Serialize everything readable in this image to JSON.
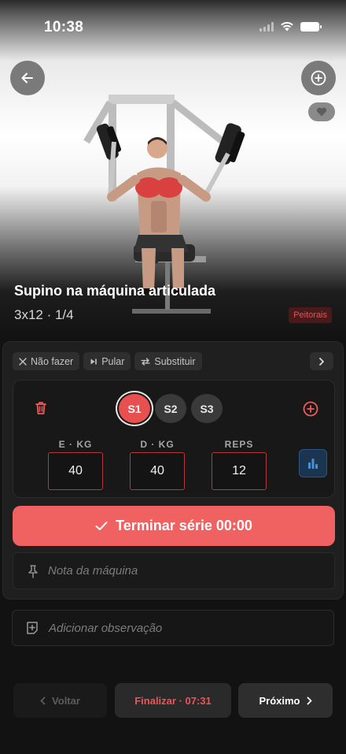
{
  "status_bar": {
    "time": "10:38"
  },
  "exercise": {
    "title": "Supino na máquina articulada",
    "meta": "3x12 · 1/4",
    "muscle": "Peitorais"
  },
  "actions": {
    "skip_label": "Não fazer",
    "jump_label": "Pular",
    "substitute_label": "Substituir"
  },
  "sets": {
    "pills": [
      "S1",
      "S2",
      "S3"
    ],
    "active": "S1"
  },
  "fields": {
    "left_label": "E · KG",
    "left_value": "40",
    "right_label": "D · KG",
    "right_value": "40",
    "reps_label": "REPS",
    "reps_value": "12"
  },
  "finish_set": {
    "label": "Terminar série 00:00"
  },
  "machine_note": {
    "placeholder": "Nota da máquina"
  },
  "observation": {
    "placeholder": "Adicionar observação"
  },
  "footer": {
    "prev_label": "Voltar",
    "finish_label": "Finalizar · 07:31",
    "next_label": "Próximo"
  },
  "colors": {
    "accent": "#f06262",
    "accent_dark": "#e8504f",
    "background": "#121212",
    "stats_blue": "#4a90d9"
  },
  "icons": {
    "back": "arrow-left-icon",
    "add": "plus-circle-icon",
    "favorite": "heart-icon",
    "skip": "x-icon",
    "jump": "skip-forward-icon",
    "substitute": "swap-icon",
    "trash": "trash-icon",
    "stats": "bar-chart-icon",
    "check": "check-icon",
    "pin": "pin-icon",
    "note_add": "note-add-icon"
  }
}
